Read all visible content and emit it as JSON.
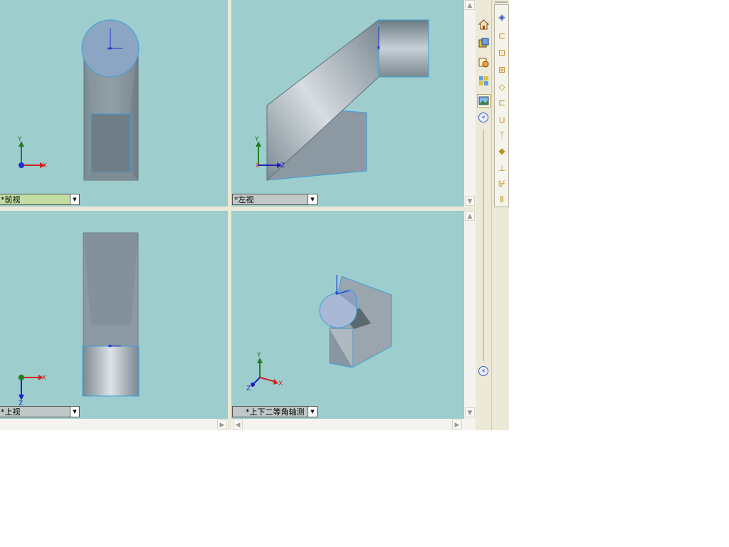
{
  "viewports": {
    "front": {
      "label": "*前视",
      "axis": {
        "x": "X",
        "y": "Y"
      }
    },
    "left": {
      "label": "*左视",
      "axis": {
        "y": "Y",
        "z": "Z",
        "x": "X"
      }
    },
    "top": {
      "label": "*上视",
      "axis": {
        "x": "X",
        "z": "Z"
      }
    },
    "iso": {
      "label": "*上下二等角轴测",
      "axis": {
        "x": "X",
        "y": "Y",
        "z": "Z"
      }
    }
  },
  "toolbar": {
    "buttons": [
      "home-icon",
      "view-palette-icon",
      "appearance-icon",
      "custom-properties-icon",
      "scene-icon"
    ],
    "collapse": "«"
  },
  "side_panel": {
    "icons": [
      "pin-icon",
      "part-icon",
      "assembly-icon",
      "drawing-icon",
      "feature-icon",
      "sketch-icon",
      "weldment-icon",
      "mold-icon",
      "sheetmetal-icon",
      "surface-icon",
      "dimension-icon",
      "annotation-icon",
      "more-icon"
    ]
  },
  "scroll": {
    "up": "▲",
    "down": "▼",
    "left": "◀",
    "right": "▶"
  },
  "colors": {
    "viewport_bg": "#9ecdcd",
    "model_edge": "#3da0d8",
    "axis_x": "#d02020",
    "axis_y": "#208020",
    "axis_z": "#2020c0"
  }
}
